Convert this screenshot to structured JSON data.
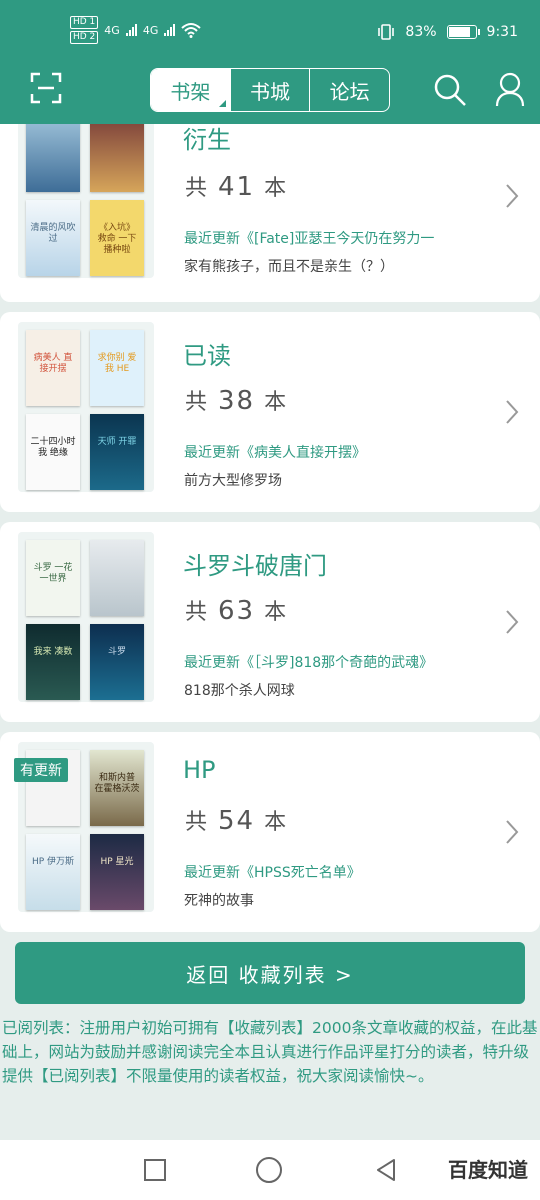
{
  "status": {
    "left_tags": [
      "HD 1",
      "HD 2"
    ],
    "net1": "4G",
    "net2": "4G",
    "battery": "83%",
    "battery_level": 0.83,
    "time": "9:31"
  },
  "header": {
    "tabs": [
      {
        "label": "书架",
        "active": true
      },
      {
        "label": "书城",
        "active": false
      },
      {
        "label": "论坛",
        "active": false
      }
    ],
    "accent": "#2f9a82"
  },
  "collections": [
    {
      "title": "衍生",
      "count_prefix": "共",
      "count": "41",
      "count_suffix": "本",
      "update": "最近更新《[Fate]亚瑟王今天仍在努力一",
      "desc": "家有熊孩子，而且不是亲生（？）",
      "covers": [
        "",
        "",
        "清晨的风吹过",
        "《入坑》 救命 一下 播种啦"
      ],
      "badge": ""
    },
    {
      "title": "已读",
      "count_prefix": "共",
      "count": "38",
      "count_suffix": "本",
      "update": "最近更新《病美人直接开摆》",
      "desc": "前方大型修罗场",
      "covers": [
        "病美人 直接开摆",
        "求你别 爱我 HE",
        "二十四小时 我 绝缘",
        "天师 开罪"
      ],
      "badge": ""
    },
    {
      "title": "斗罗斗破唐门",
      "count_prefix": "共",
      "count": "63",
      "count_suffix": "本",
      "update": "最近更新《［斗罗]818那个奇葩的武魂》",
      "desc": "818那个杀人网球",
      "covers": [
        "斗罗 一花一世界",
        "",
        "我来 凑数",
        "斗罗"
      ],
      "badge": ""
    },
    {
      "title": "HP",
      "count_prefix": "共",
      "count": "54",
      "count_suffix": "本",
      "update": "最近更新《HPSS死亡名单》",
      "desc": "死神的故事",
      "covers": [
        "",
        "和斯内普 在霍格沃茨",
        "HP 伊万斯",
        "HP 星光"
      ],
      "badge": "有更新"
    }
  ],
  "return_button": "返回 收藏列表 >",
  "notice": "已阅列表：注册用户初始可拥有【收藏列表】2000条文章收藏的权益，在此基础上，网站为鼓励并感谢阅读完全本且认真进行作品评星打分的读者，特升级提供【已阅列表】不限量使用的读者权益，祝大家阅读愉快~。",
  "watermark": "百度知道"
}
